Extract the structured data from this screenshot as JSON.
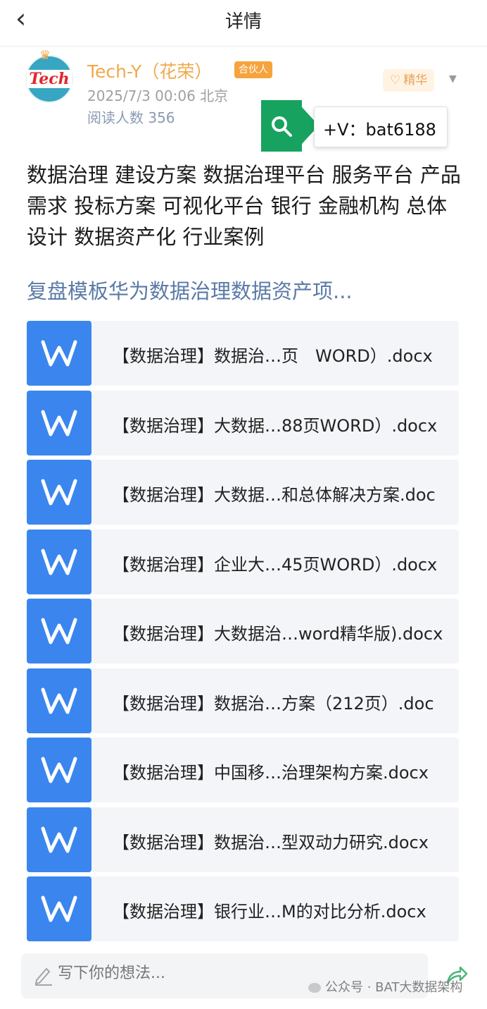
{
  "header": {
    "title": "详情",
    "back_glyph": "‹"
  },
  "post": {
    "author": "Tech-Y（花荣）",
    "badge": "合伙人",
    "meta": "2025/7/3 00:06 北京",
    "reads": "阅读人数 356",
    "featured": "精华",
    "avatar_text": "Tech",
    "tags": "数据治理 建设方案 数据治理平台 服务平台 产品需求 投标方案 可视化平台 银行 金融机构 总体设计 数据资产化 行业案例",
    "doc_title": "复盘模板华为数据治理数据资产项..."
  },
  "contact": {
    "text": "+V：bat6188"
  },
  "files": [
    {
      "name": "【数据治理】数据治…页　WORD）.docx"
    },
    {
      "name": "【数据治理】大数据…88页WORD）.docx"
    },
    {
      "name": "【数据治理】大数据…和总体解决方案.doc"
    },
    {
      "name": "【数据治理】企业大…45页WORD）.docx"
    },
    {
      "name": "【数据治理】大数据治…word精华版).docx"
    },
    {
      "name": "【数据治理】数据治…方案（212页）.doc"
    },
    {
      "name": "【数据治理】中国移…治理架构方案.docx"
    },
    {
      "name": "【数据治理】数据治…型双动力研究.docx"
    },
    {
      "name": "【数据治理】银行业…M的对比分析.docx"
    }
  ],
  "comment": {
    "placeholder": "写下你的想法..."
  },
  "watermark": "公众号 · BAT大数据架构",
  "colors": {
    "accent_orange": "#f0a94b",
    "link_blue": "#5b7aa6",
    "file_blue": "#3a86ee",
    "wechat_green": "#17a35f"
  }
}
